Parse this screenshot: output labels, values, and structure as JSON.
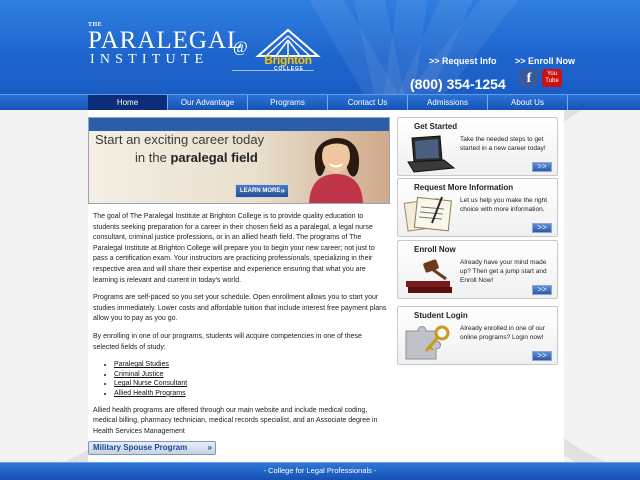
{
  "header": {
    "logo": {
      "the": "THE",
      "paralegal": "PARALEGAL",
      "institute": "INSTITUTE",
      "at": "@",
      "brighton": "Brighton",
      "college": "COLLEGE"
    },
    "links": [
      ">> Request Info",
      ">> Enroll Now"
    ],
    "phone": "(800) 354-1254",
    "facebook_icon": "f",
    "youtube_icon": "You Tube"
  },
  "nav": {
    "items": [
      "Home",
      "Our Advantage",
      "Programs",
      "Contact Us",
      "Admissions",
      "About Us"
    ],
    "active_index": 0
  },
  "banner": {
    "line1": "Start an exciting career today",
    "line2_prefix": "in the",
    "line2_bold": "paralegal field",
    "learn_more": "LEARN MORE"
  },
  "main": {
    "p1": "The goal of The Paralegal Institute at Brighton College is to provide quality education to students seeking preparation for a career in their chosen field as a paralegal, a legal nurse consultant, criminal justice professions, or in an allied heath field. The programs of The Paralegal Institute at Brighton College will prepare you to begin your new career; not just to pass a certification exam. Your instructors are practicing professionals, specializing in their respective area and will share their expertise and experience ensuring that what you are learning is relevant and current in today's world.",
    "p2": "Programs are self-paced so you set your schedule. Open enrollment allows you to start your studies immediately. Lower costs and affordable tuition that include interest free payment plans allow you to pay as you go.",
    "p3": "By enrolling in one of our programs, students will acquire competencies in one of these selected fields of study:",
    "fields": [
      "Paralegal Studies",
      "Criminal Justice",
      "Legal Nurse Consultant",
      "Allied Health Programs"
    ],
    "p4": "Allied health programs are offered through our main website and include medical coding, medical billing, pharmacy technician, medical records specialist, and an Associate degree in Health Services Management",
    "military_button": "Military Spouse Program"
  },
  "sidebar": [
    {
      "title": "Get Started",
      "desc": "Take the needed steps to get started in a new career today!",
      "icon": "laptop-icon"
    },
    {
      "title": "Request More Information",
      "desc": "Let us help you make the right choice with more information.",
      "icon": "documents-icon"
    },
    {
      "title": "Enroll Now",
      "desc": "Already have your mind made up? Then get a jump start and Enroll Now!",
      "icon": "gavel-icon"
    },
    {
      "title": "Student Login",
      "desc": "Already enrolled in one of our online programs? Login now!",
      "icon": "puzzle-key-icon"
    }
  ],
  "sidebar_go_label": ">>",
  "footer": {
    "text": "- College for Legal Professionals -"
  },
  "colors": {
    "header_blue": "#1d64cc",
    "nav_active": "#0b2d7a",
    "brand_gold": "#f3c316"
  }
}
